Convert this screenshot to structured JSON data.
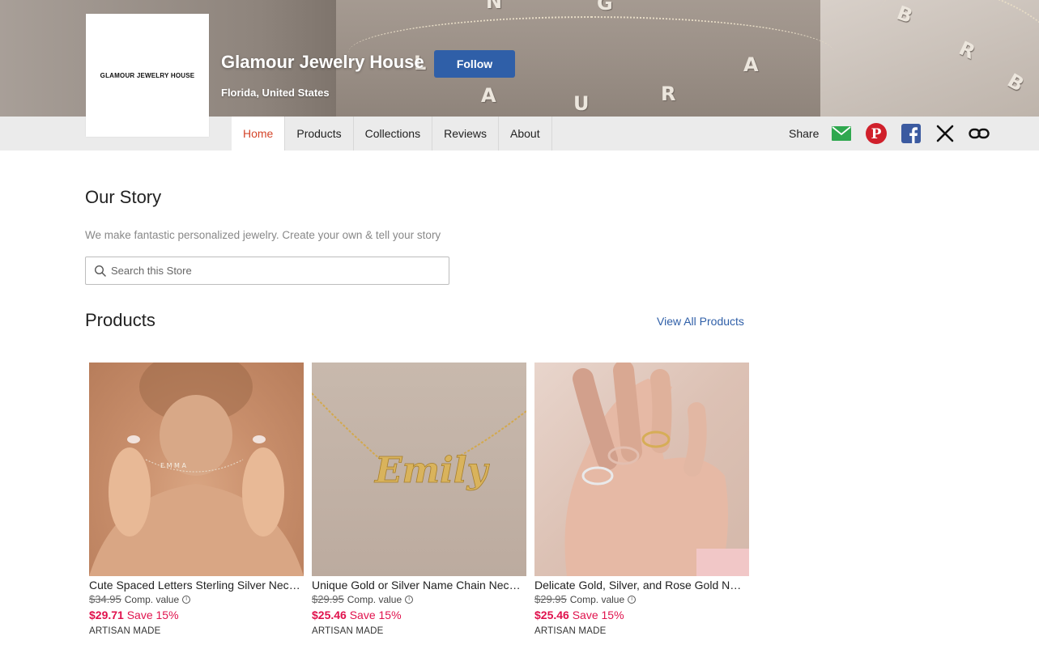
{
  "store": {
    "logo_text": "GLAMOUR JEWELRY HOUSE",
    "name": "Glamour Jewelry House",
    "location": "Florida, United States",
    "follow_label": "Follow"
  },
  "nav": {
    "tabs": [
      {
        "label": "Home",
        "active": true
      },
      {
        "label": "Products",
        "active": false
      },
      {
        "label": "Collections",
        "active": false
      },
      {
        "label": "Reviews",
        "active": false
      },
      {
        "label": "About",
        "active": false
      }
    ],
    "share_label": "Share",
    "share_icons": [
      "email-icon",
      "pinterest-icon",
      "facebook-icon",
      "x-icon",
      "link-icon"
    ]
  },
  "story": {
    "title": "Our Story",
    "text": "We make fantastic personalized jewelry. Create your own & tell your story"
  },
  "search": {
    "placeholder": "Search this Store",
    "value": ""
  },
  "products": {
    "title": "Products",
    "view_all_label": "View All Products",
    "items": [
      {
        "title": "Cute Spaced Letters Sterling Silver Neckl...",
        "compare_price": "$34.95",
        "compare_label": "Comp. value",
        "price": "$29.71",
        "save": "Save 15%",
        "badge": "ARTISAN MADE",
        "image_text": "E M M A"
      },
      {
        "title": "Unique Gold or Silver Name Chain Neckl...",
        "compare_price": "$29.95",
        "compare_label": "Comp. value",
        "price": "$25.46",
        "save": "Save 15%",
        "badge": "ARTISAN MADE",
        "image_text": "Emily"
      },
      {
        "title": "Delicate Gold, Silver, and Rose Gold Nam...",
        "compare_price": "$29.95",
        "compare_label": "Comp. value",
        "price": "$25.46",
        "save": "Save 15%",
        "badge": "ARTISAN MADE",
        "image_text": ""
      }
    ]
  },
  "colors": {
    "accent_blue": "#2f5fa8",
    "active_tab": "#d4452a",
    "price_red": "#e0124d"
  }
}
